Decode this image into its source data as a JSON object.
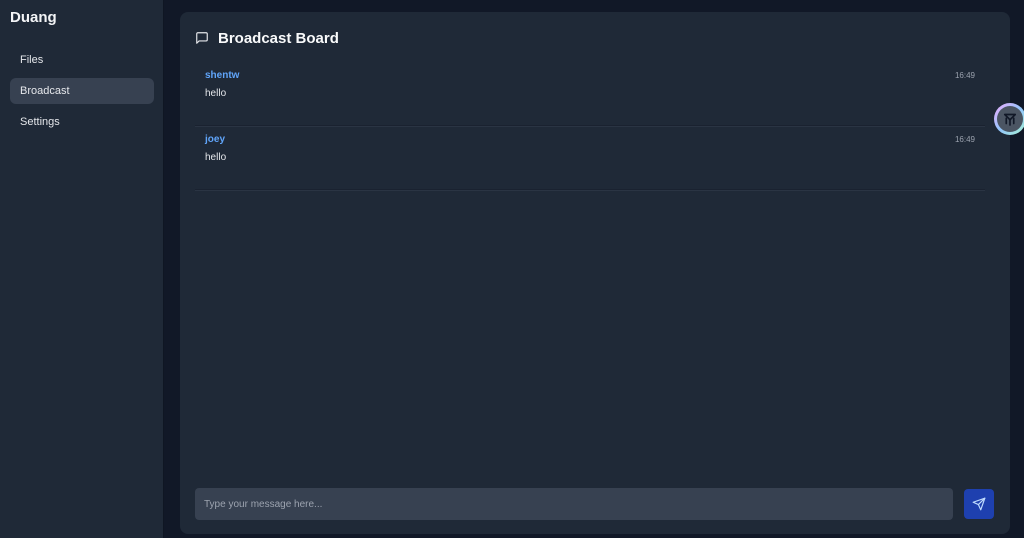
{
  "sidebar": {
    "brand": "Duang",
    "items": [
      {
        "label": "Files",
        "active": false
      },
      {
        "label": "Broadcast",
        "active": true
      },
      {
        "label": "Settings",
        "active": false
      }
    ]
  },
  "main": {
    "title": "Broadcast Board",
    "title_icon": "message-square-icon",
    "messages": [
      {
        "user": "shentw",
        "time": "16:49",
        "text": "hello"
      },
      {
        "user": "joey",
        "time": "16:49",
        "text": "hello"
      }
    ],
    "composer": {
      "placeholder": "Type your message here...",
      "value": "",
      "send_icon": "send-icon"
    }
  },
  "floating_widget": {
    "icon": "assistant-widget-icon"
  },
  "colors": {
    "background": "#111827",
    "panel": "#1f2937",
    "active_nav": "#374151",
    "username": "#60a5fa",
    "send_button": "#1e40af"
  }
}
